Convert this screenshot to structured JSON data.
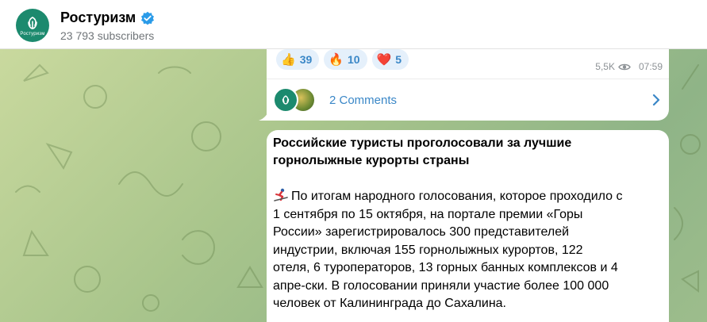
{
  "header": {
    "channel_name": "Ростуризм",
    "subscribers": "23 793 subscribers",
    "avatar_label": "Ростуризм"
  },
  "previous_post": {
    "reactions": [
      {
        "emoji": "👍",
        "icon": "thumbs-up-icon",
        "count": "39"
      },
      {
        "emoji": "🔥",
        "icon": "fire-icon",
        "count": "10"
      },
      {
        "emoji": "❤️",
        "icon": "heart-icon",
        "count": "5"
      }
    ],
    "views": "5,5K",
    "time": "07:59",
    "comments_label": "2 Comments"
  },
  "post": {
    "title_line1": "Российские туристы проголосовали за лучшие",
    "title_line2": "горнолыжные курорты страны",
    "body_lines": [
      "По итогам народного голосования, которое проходило с",
      "1 сентября по 15 октября, на портале премии «Горы",
      "России» зарегистрировалось 300 представителей",
      "индустрии, включая 155 горнолыжных курортов, 122",
      "отеля, 6 туроператоров, 13 горных банных комплексов и 4",
      "апре-ски. В голосовании приняли участие более 100 000",
      "человек от Калининграда до Сахалина."
    ]
  },
  "colors": {
    "accent": "#3a87c7",
    "brand": "#1c8a6e",
    "verified": "#2a9be8"
  }
}
